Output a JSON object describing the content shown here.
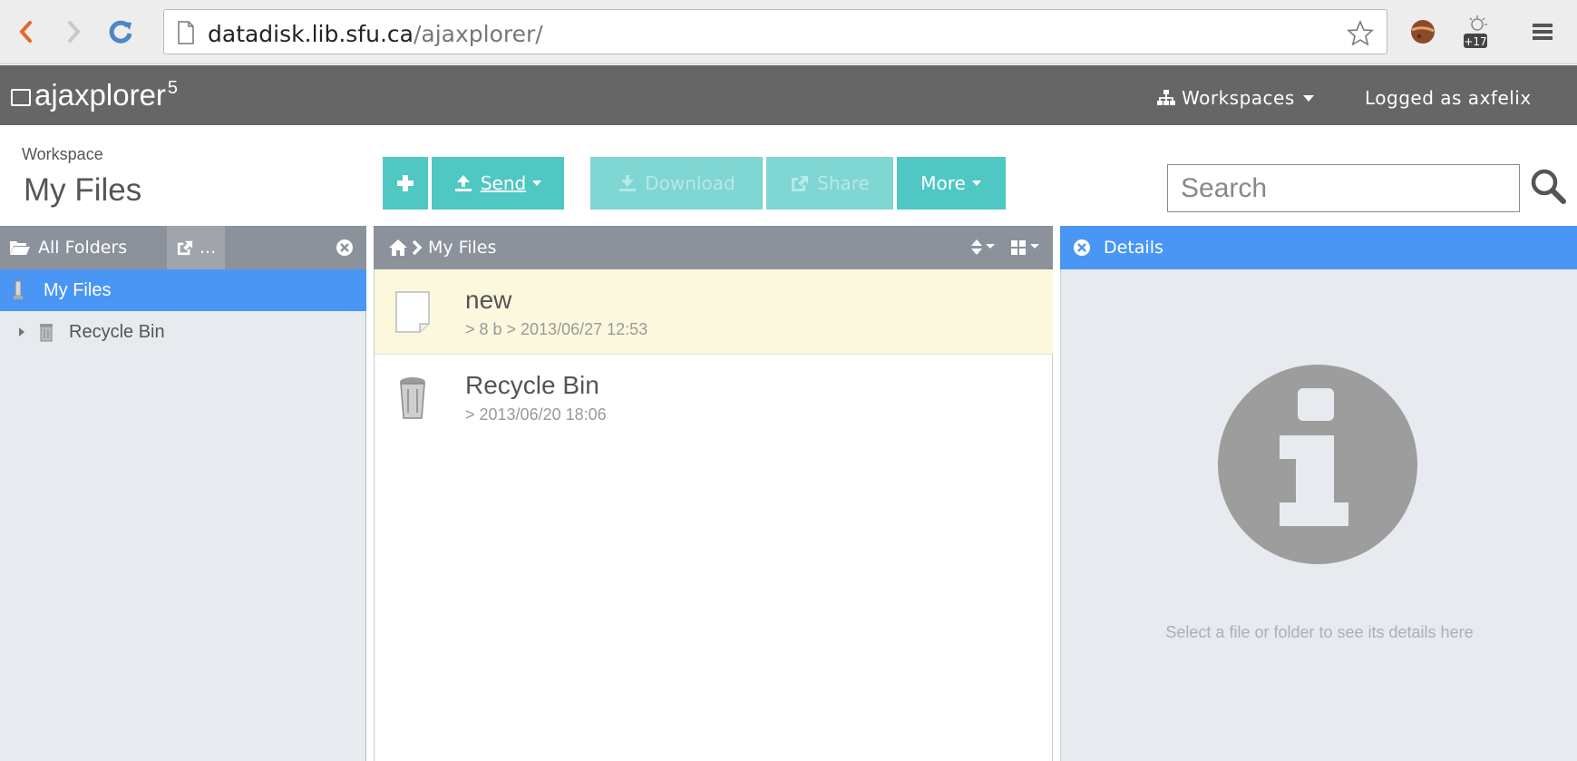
{
  "browser": {
    "url_host": "datadisk.lib.sfu.ca",
    "url_path": "/ajaxplorer/",
    "badge": "+17"
  },
  "header": {
    "logo_text": "ajaxplorer",
    "logo_sup": "5",
    "workspaces_label": "Workspaces",
    "logged_label": "Logged as axfelix"
  },
  "workspace": {
    "label": "Workspace",
    "title": "My Files"
  },
  "toolbar": {
    "send_label": "Send",
    "download_label": "Download",
    "share_label": "Share",
    "more_label": "More"
  },
  "search": {
    "placeholder": "Search"
  },
  "left_panel": {
    "title": "All Folders",
    "extra": "...",
    "items": [
      {
        "label": "My Files"
      },
      {
        "label": "Recycle Bin"
      }
    ]
  },
  "mid_panel": {
    "breadcrumb": "My Files",
    "files": [
      {
        "name": "new",
        "meta": "> 8 b > 2013/06/27 12:53"
      },
      {
        "name": "Recycle Bin",
        "meta": "> 2013/06/20 18:06"
      }
    ]
  },
  "right_panel": {
    "title": "Details",
    "message": "Select a file or folder to see its details here"
  },
  "colors": {
    "toolbar": "#4fc7c2",
    "header": "#666666",
    "selected_tree": "#4a96f5",
    "details_head": "#4a96f5",
    "panel_head": "#8c929c",
    "selected_file": "#fbf8dd"
  }
}
